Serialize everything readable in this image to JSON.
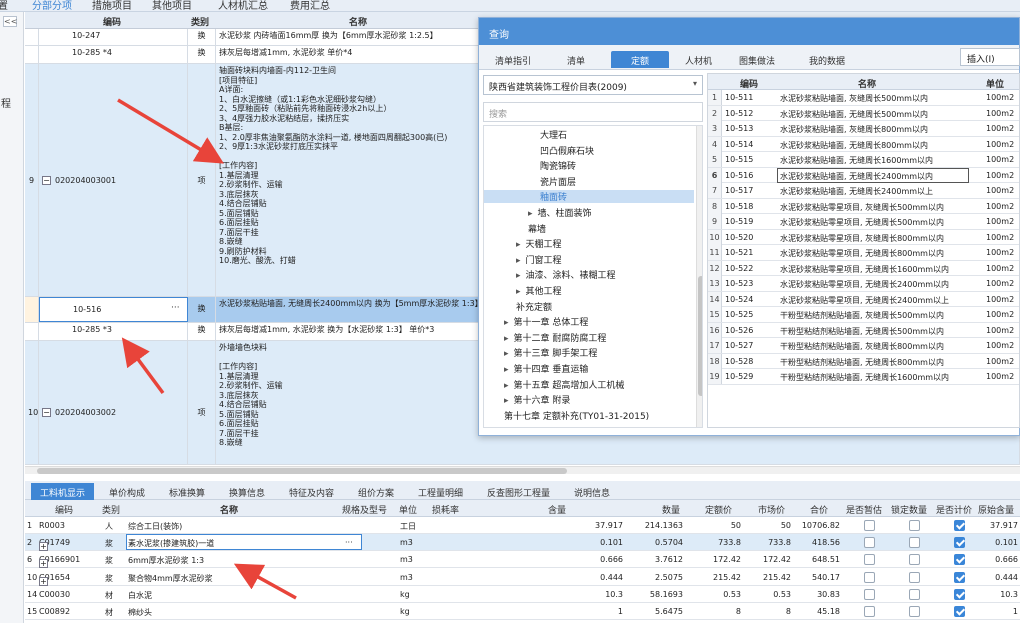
{
  "top_tabs": [
    "置",
    "分部分项",
    "措施项目",
    "其他项目",
    "人材机汇总",
    "费用汇总"
  ],
  "left_strip": {
    "collapse": "<<",
    "chars": [
      "程"
    ]
  },
  "grid_header": {
    "code": "编码",
    "type": "类别",
    "name": "名称"
  },
  "grid_rows": [
    {
      "no": "",
      "code": "10-247",
      "type": "换",
      "name": "水泥砂浆 内砖墙面16mm厚  换为【6mm厚水泥砂浆 1:2.5】"
    },
    {
      "no": "",
      "code": "10-285 *4",
      "type": "换",
      "name": "抹灰层每增减1mm, 水泥砂浆  单价*4"
    },
    {
      "no": "9",
      "code": "020204003001",
      "type": "项",
      "name": "轴面砖块料内墙面-内112-卫生间\n[项目特征]\nA详面:\n1、白水泥擦缝（或1:1彩色水泥细砂浆勾缝）\n2、5厚釉面砖（粘贴前先将釉面砖浸水2h以上）\n3、4厚强力胶水泥粘结层，揉挤压实\nB基层:\n1、2.0厚非焦油聚氨酯防水涂料一道, 楼地面四周翻起300高(已)\n2、9厚1:3水泥砂浆打底压实抹平\n\n[工作内容]\n1.基层清理\n2.砂浆制作、运输\n3.底层抹灰\n4.结合层铺贴\n5.面层铺贴\n6.面层挂贴\n7.面层干挂\n8.嵌缝\n9.刷防护材料\n10.磨光、酸洗、打蜡"
    },
    {
      "no": "",
      "code": "10-516",
      "type": "换",
      "name": "水泥砂浆粘贴墙面, 无缝周长2400mm以内  换为【5mm厚水泥砂浆 1:3】",
      "more": "···"
    },
    {
      "no": "",
      "code": "10-285 *3",
      "type": "换",
      "name": "抹灰层每增减1mm, 水泥砂浆  换为【水泥砂浆 1:3】  单价*3"
    },
    {
      "no": "10",
      "code": "020204003002",
      "type": "项",
      "name": "外墙墙色块料\n\n[工作内容]\n1.基层清理\n2.砂浆制作、运输\n3.底层抹灰\n4.结合层铺贴\n5.面层铺贴\n6.面层挂贴\n7.面层干挂\n8.嵌缝"
    }
  ],
  "dialog": {
    "title": "查询",
    "tabs": [
      "清单指引",
      "清单",
      "定额",
      "人材机",
      "图集做法",
      "我的数据"
    ],
    "active_tab": "定额",
    "insert_label": "插入(I)",
    "library": "陕西省建筑装饰工程价目表(2009)",
    "search_placeholder": "搜索",
    "tree": [
      {
        "label": "大理石",
        "indent": 3,
        "arrow": ""
      },
      {
        "label": "凹凸假麻石块",
        "indent": 3,
        "arrow": ""
      },
      {
        "label": "陶瓷锦砖",
        "indent": 3,
        "arrow": ""
      },
      {
        "label": "瓷片面层",
        "indent": 3,
        "arrow": ""
      },
      {
        "label": "釉面砖",
        "indent": 3,
        "arrow": "",
        "selected": true
      },
      {
        "label": "墙、柱面装饰",
        "indent": 2,
        "arrow": "▸"
      },
      {
        "label": "幕墙",
        "indent": 2,
        "arrow": ""
      },
      {
        "label": "天棚工程",
        "indent": 1,
        "arrow": "▸"
      },
      {
        "label": "门窗工程",
        "indent": 1,
        "arrow": "▸"
      },
      {
        "label": "油漆、涂料、裱糊工程",
        "indent": 1,
        "arrow": "▸"
      },
      {
        "label": "其他工程",
        "indent": 1,
        "arrow": "▸"
      },
      {
        "label": "补充定额",
        "indent": 1,
        "arrow": ""
      },
      {
        "label": "第十一章 总体工程",
        "indent": 0,
        "arrow": "▸"
      },
      {
        "label": "第十二章 耐腐防腐工程",
        "indent": 0,
        "arrow": "▸"
      },
      {
        "label": "第十三章 脚手架工程",
        "indent": 0,
        "arrow": "▸"
      },
      {
        "label": "第十四章 垂直运输",
        "indent": 0,
        "arrow": "▸"
      },
      {
        "label": "第十五章 超高增加人工机械",
        "indent": 0,
        "arrow": "▸"
      },
      {
        "label": "第十六章 附录",
        "indent": 0,
        "arrow": "▸"
      },
      {
        "label": "第十七章 定额补充(TY01-31-2015)",
        "indent": 0,
        "arrow": ""
      }
    ],
    "table_header": {
      "code": "编码",
      "name": "名称",
      "unit": "单位"
    },
    "rows": [
      {
        "no": "1",
        "code": "10-511",
        "name": "水泥砂浆粘贴墙面, 灰缝周长500mm以内",
        "unit": "100m2"
      },
      {
        "no": "2",
        "code": "10-512",
        "name": "水泥砂浆粘贴墙面, 无缝周长500mm以内",
        "unit": "100m2"
      },
      {
        "no": "3",
        "code": "10-513",
        "name": "水泥砂浆粘贴墙面, 灰缝周长800mm以内",
        "unit": "100m2"
      },
      {
        "no": "4",
        "code": "10-514",
        "name": "水泥砂浆粘贴墙面, 无缝周长800mm以内",
        "unit": "100m2"
      },
      {
        "no": "5",
        "code": "10-515",
        "name": "水泥砂浆粘贴墙面, 无缝周长1600mm以内",
        "unit": "100m2"
      },
      {
        "no": "6",
        "code": "10-516",
        "name": "水泥砂浆粘贴墙面, 无缝周长2400mm以内",
        "unit": "100m2"
      },
      {
        "no": "7",
        "code": "10-517",
        "name": "水泥砂浆粘贴墙面, 无缝周长2400mm以上",
        "unit": "100m2"
      },
      {
        "no": "8",
        "code": "10-518",
        "name": "水泥砂浆粘贴零星项目, 灰缝周长500mm以内",
        "unit": "100m2"
      },
      {
        "no": "9",
        "code": "10-519",
        "name": "水泥砂浆粘贴零星项目, 无缝周长500mm以内",
        "unit": "100m2"
      },
      {
        "no": "10",
        "code": "10-520",
        "name": "水泥砂浆粘贴零星项目, 灰缝周长800mm以内",
        "unit": "100m2"
      },
      {
        "no": "11",
        "code": "10-521",
        "name": "水泥砂浆粘贴零星项目, 无缝周长800mm以内",
        "unit": "100m2"
      },
      {
        "no": "12",
        "code": "10-522",
        "name": "水泥砂浆粘贴零星项目, 无缝周长1600mm以内",
        "unit": "100m2"
      },
      {
        "no": "13",
        "code": "10-523",
        "name": "水泥砂浆粘贴零星项目, 无缝周长2400mm以内",
        "unit": "100m2"
      },
      {
        "no": "14",
        "code": "10-524",
        "name": "水泥砂浆粘贴零星项目, 无缝周长2400mm以上",
        "unit": "100m2"
      },
      {
        "no": "15",
        "code": "10-525",
        "name": "干粉型粘结剂粘贴墙面, 灰缝周长500mm以内",
        "unit": "100m2"
      },
      {
        "no": "16",
        "code": "10-526",
        "name": "干粉型粘结剂粘贴墙面, 无缝周长500mm以内",
        "unit": "100m2"
      },
      {
        "no": "17",
        "code": "10-527",
        "name": "干粉型粘结剂粘贴墙面, 灰缝周长800mm以内",
        "unit": "100m2"
      },
      {
        "no": "18",
        "code": "10-528",
        "name": "干粉型粘结剂粘贴墙面, 无缝周长800mm以内",
        "unit": "100m2"
      },
      {
        "no": "19",
        "code": "10-529",
        "name": "干粉型粘结剂粘贴墙面, 无缝周长1600mm以内",
        "unit": "100m2"
      }
    ],
    "selected_row": "6"
  },
  "bottom_tabs": [
    "工料机显示",
    "单价构成",
    "标准换算",
    "换算信息",
    "特征及内容",
    "组价方案",
    "工程量明细",
    "反查图形工程量",
    "说明信息"
  ],
  "bottom_active": "工料机显示",
  "bottom_header": {
    "code": "编码",
    "type": "类别",
    "name": "名称",
    "spec": "规格及型号",
    "unit": "单位",
    "loss": "损耗率",
    "content": "含量",
    "qty": "数量",
    "dprice": "定额价",
    "mprice": "市场价",
    "total": "合价",
    "prov": "是否暂估",
    "lock": "锁定数量",
    "calc": "是否计价",
    "orig": "原始含量"
  },
  "bottom_rows": [
    {
      "no": "1",
      "plus": false,
      "code": "R0003",
      "type": "人",
      "name": "综合工日(装饰)",
      "unit": "工日",
      "content": "37.917",
      "qty": "214.1363",
      "dprice": "50",
      "mprice": "50",
      "total": "10706.82",
      "calc": true,
      "orig": "37.917"
    },
    {
      "no": "2",
      "plus": true,
      "code": "C01749",
      "type": "浆",
      "name": "素水泥浆(掺建筑胶)一道",
      "unit": "m3",
      "content": "0.101",
      "qty": "0.5704",
      "dprice": "733.8",
      "mprice": "733.8",
      "total": "418.56",
      "calc": true,
      "orig": "0.101",
      "more": "···"
    },
    {
      "no": "6",
      "plus": true,
      "code": "C0166901",
      "type": "浆",
      "name": "6mm厚水泥砂浆 1:3",
      "unit": "m3",
      "content": "0.666",
      "qty": "3.7612",
      "dprice": "172.42",
      "mprice": "172.42",
      "total": "648.51",
      "calc": true,
      "orig": "0.666"
    },
    {
      "no": "10",
      "plus": true,
      "code": "C01654",
      "type": "浆",
      "name": "聚合物4mm厚水泥砂浆",
      "unit": "m3",
      "content": "0.444",
      "qty": "2.5075",
      "dprice": "215.42",
      "mprice": "215.42",
      "total": "540.17",
      "calc": true,
      "orig": "0.444"
    },
    {
      "no": "14",
      "plus": false,
      "code": "C00030",
      "type": "材",
      "name": "白水泥",
      "unit": "kg",
      "content": "10.3",
      "qty": "58.1693",
      "dprice": "0.53",
      "mprice": "0.53",
      "total": "30.83",
      "calc": true,
      "orig": "10.3"
    },
    {
      "no": "15",
      "plus": false,
      "code": "C00892",
      "type": "材",
      "name": "棉纱头",
      "unit": "kg",
      "content": "1",
      "qty": "5.6475",
      "dprice": "8",
      "mprice": "8",
      "total": "45.18",
      "calc": true,
      "orig": "1"
    }
  ],
  "colors": {
    "accent": "#3f86d4",
    "arrow": "#e8443a",
    "highlight": "#ddebf8",
    "selected": "#a8cbee"
  }
}
